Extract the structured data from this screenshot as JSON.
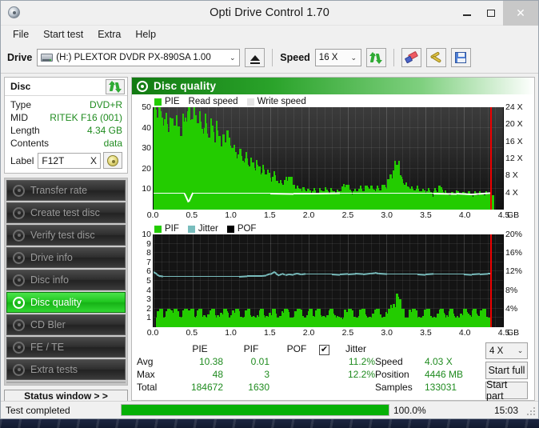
{
  "window": {
    "title": "Opti Drive Control 1.70",
    "app_icon": "disc-icon",
    "minimize": "–",
    "maximize": "□",
    "close": "✕"
  },
  "menu": {
    "items": [
      "File",
      "Start test",
      "Extra",
      "Help"
    ]
  },
  "toolbar": {
    "drive_label": "Drive",
    "drive_value": "(H:)  PLEXTOR DVDR  PX-890SA 1.00",
    "eject_tooltip": "Eject",
    "speed_label": "Speed",
    "speed_value": "16 X",
    "caret": "⌄",
    "icons": [
      "refresh-icon",
      "eraser-icon",
      "tools-icon",
      "save-icon"
    ]
  },
  "disc_panel": {
    "title": "Disc",
    "refresh_icon": "refresh-icon",
    "rows": [
      {
        "key": "Type",
        "value": "DVD+R"
      },
      {
        "key": "MID",
        "value": "RITEK F16 (001)"
      },
      {
        "key": "Length",
        "value": "4.34 GB"
      },
      {
        "key": "Contents",
        "value": "data"
      }
    ],
    "label_key": "Label",
    "label_value": "F12T",
    "label_clear": "X",
    "label_button_icon": "disc-icon"
  },
  "nav": {
    "items": [
      {
        "label": "Transfer rate",
        "icon": "disc-test-icon",
        "active": false
      },
      {
        "label": "Create test disc",
        "icon": "disc-test-icon",
        "active": false
      },
      {
        "label": "Verify test disc",
        "icon": "disc-test-icon",
        "active": false
      },
      {
        "label": "Drive info",
        "icon": "disc-info-icon",
        "active": false
      },
      {
        "label": "Disc info",
        "icon": "disc-info-icon",
        "active": false
      },
      {
        "label": "Disc quality",
        "icon": "disc-quality-icon",
        "active": true
      },
      {
        "label": "CD Bler",
        "icon": "disc-test-icon",
        "active": false
      },
      {
        "label": "FE / TE",
        "icon": "disc-test-icon",
        "active": false
      },
      {
        "label": "Extra tests",
        "icon": "disc-test-icon",
        "active": false
      }
    ],
    "status_window_button": "Status window > >"
  },
  "main": {
    "header_title": "Disc quality",
    "header_icon": "disc-quality-icon"
  },
  "stats": {
    "headers": [
      "PIE",
      "PIF",
      "POF",
      "Jitter"
    ],
    "jitter_checked": true,
    "jitter_check_glyph": "✔",
    "rows": [
      {
        "label": "Avg",
        "pie": "10.38",
        "pif": "0.01",
        "pof": "",
        "jitter": "11.2%"
      },
      {
        "label": "Max",
        "pie": "48",
        "pif": "3",
        "pof": "",
        "jitter": "12.2%"
      },
      {
        "label": "Total",
        "pie": "184672",
        "pif": "1630",
        "pof": "",
        "jitter": ""
      }
    ],
    "speed_key": "Speed",
    "speed_value": "4.03 X",
    "position_key": "Position",
    "position_value": "4446 MB",
    "samples_key": "Samples",
    "samples_value": "133031",
    "test_speed_value": "4 X",
    "caret": "⌄",
    "start_full": "Start full",
    "start_part": "Start part"
  },
  "statusbar": {
    "text": "Test completed",
    "percent_label": "100.0%",
    "percent_value": 100,
    "time": "15:03"
  },
  "colors": {
    "pie_green": "#23cc00",
    "pif_green": "#23cc00",
    "jitter_teal": "#79bdbd",
    "read_speed_white": "#ffffff",
    "marker_red": "#ee0000",
    "accent_green": "#1fc51f",
    "value_green": "#1f8b1f"
  },
  "chart_data": [
    {
      "type": "area",
      "name": "pie-chart",
      "title": "PIE",
      "legend": [
        {
          "label": "PIE",
          "swatch": "#23cc00"
        },
        {
          "label": "Read speed",
          "swatch": "#ffffff"
        },
        {
          "label": "Write speed",
          "swatch": "#e4e4e4"
        }
      ],
      "xlabel": "GB",
      "xlim": [
        0,
        4.5
      ],
      "xticks": [
        0.0,
        0.5,
        1.0,
        1.5,
        2.0,
        2.5,
        3.0,
        3.5,
        4.0,
        4.5
      ],
      "xticklabels": [
        "0.0",
        "0.5",
        "1.0",
        "1.5",
        "2.0",
        "2.5",
        "3.0",
        "3.5",
        "4.0",
        "4.5"
      ],
      "ylim": [
        0,
        50
      ],
      "yticks": [
        10,
        20,
        30,
        40,
        50
      ],
      "yticklabels": [
        "10",
        "20",
        "30",
        "40",
        "50"
      ],
      "y2lim": [
        0,
        24
      ],
      "y2ticks": [
        4,
        8,
        12,
        16,
        20,
        24
      ],
      "y2ticklabels": [
        "4 X",
        "8 X",
        "12 X",
        "16 X",
        "20 X",
        "24 X"
      ],
      "grid": true,
      "data_end_x": 4.34,
      "marker_x": 4.34,
      "series": [
        {
          "name": "PIE",
          "kind": "bars",
          "x": [
            0.0,
            0.04,
            0.09,
            0.13,
            0.17,
            0.22,
            0.26,
            0.3,
            0.35,
            0.39,
            0.43,
            0.48,
            0.52,
            0.56,
            0.61,
            0.65,
            0.69,
            0.74,
            0.78,
            0.82,
            0.87,
            0.91,
            0.95,
            1.0,
            1.04,
            1.08,
            1.13,
            1.17,
            1.21,
            1.26,
            1.3,
            1.34,
            1.39,
            1.43,
            1.47,
            1.52,
            1.56,
            1.6,
            1.65,
            1.69,
            1.73,
            1.78,
            1.82,
            1.86,
            1.91,
            1.95,
            1.99,
            2.04,
            2.08,
            2.12,
            2.17,
            2.21,
            2.25,
            2.3,
            2.34,
            2.38,
            2.43,
            2.47,
            2.51,
            2.56,
            2.6,
            2.64,
            2.69,
            2.73,
            2.77,
            2.82,
            2.86,
            2.9,
            2.95,
            2.99,
            3.03,
            3.08,
            3.12,
            3.16,
            3.21,
            3.25,
            3.29,
            3.34,
            3.38,
            3.42,
            3.47,
            3.51,
            3.55,
            3.6,
            3.64,
            3.68,
            3.73,
            3.77,
            3.81,
            3.86,
            3.9,
            3.94,
            3.99,
            4.03,
            4.07,
            4.12,
            4.16,
            4.2,
            4.25,
            4.29,
            4.34
          ],
          "values": [
            49,
            45,
            41,
            44,
            38,
            34,
            41,
            39,
            36,
            43,
            48,
            44,
            40,
            42,
            37,
            40,
            35,
            38,
            33,
            36,
            31,
            33,
            29,
            30,
            25,
            27,
            23,
            25,
            21,
            22,
            19,
            21,
            18,
            17,
            15,
            16,
            14,
            13,
            12,
            11,
            16,
            12,
            10,
            10,
            9,
            9,
            8,
            9,
            8,
            8,
            9,
            9,
            8,
            9,
            8,
            9,
            9,
            12,
            9,
            9,
            8,
            10,
            9,
            11,
            10,
            9,
            10,
            9,
            11,
            10,
            14,
            19,
            22,
            16,
            12,
            11,
            10,
            9,
            10,
            9,
            8,
            9,
            8,
            9,
            8,
            11,
            8,
            7,
            7,
            8,
            7,
            8,
            7,
            8,
            7,
            8,
            7,
            8,
            7,
            8,
            7
          ]
        },
        {
          "name": "Read speed",
          "kind": "line",
          "axis": "right",
          "x": [
            0.0,
            0.2,
            0.4,
            0.45,
            0.5,
            0.6,
            0.9,
            1.2,
            1.5,
            1.8,
            2.1,
            2.4,
            2.7,
            3.0,
            3.3,
            3.6,
            3.9,
            4.1,
            4.34
          ],
          "values": [
            4.0,
            4.0,
            4.0,
            2.0,
            4.0,
            4.0,
            4.0,
            4.0,
            4.0,
            3.9,
            3.9,
            4.0,
            4.0,
            4.0,
            4.0,
            4.0,
            3.9,
            3.7,
            4.0
          ]
        }
      ]
    },
    {
      "type": "area",
      "name": "pif-jitter-chart",
      "title": "PIF / Jitter / POF",
      "legend": [
        {
          "label": "PIF",
          "swatch": "#23cc00"
        },
        {
          "label": "Jitter",
          "swatch": "#79bdbd"
        },
        {
          "label": "POF",
          "swatch": "#000000"
        }
      ],
      "xlabel": "GB",
      "xlim": [
        0,
        4.5
      ],
      "xticks": [
        0.0,
        0.5,
        1.0,
        1.5,
        2.0,
        2.5,
        3.0,
        3.5,
        4.0,
        4.5
      ],
      "xticklabels": [
        "0.0",
        "0.5",
        "1.0",
        "1.5",
        "2.0",
        "2.5",
        "3.0",
        "3.5",
        "4.0",
        "4.5"
      ],
      "ylim": [
        0,
        10
      ],
      "yticks": [
        1,
        2,
        3,
        4,
        5,
        6,
        7,
        8,
        9,
        10
      ],
      "yticklabels": [
        "1",
        "2",
        "3",
        "4",
        "5",
        "6",
        "7",
        "8",
        "9",
        "10"
      ],
      "y2lim": [
        0,
        20
      ],
      "y2ticks": [
        4,
        8,
        12,
        16,
        20
      ],
      "y2ticklabels": [
        "4%",
        "8%",
        "12%",
        "16%",
        "20%"
      ],
      "grid": true,
      "data_end_x": 4.34,
      "marker_x": 4.34,
      "series": [
        {
          "name": "PIF",
          "kind": "bars",
          "x": [
            0.03,
            0.07,
            0.1,
            0.14,
            0.17,
            0.21,
            0.26,
            0.31,
            0.35,
            0.39,
            0.44,
            0.47,
            0.5,
            0.54,
            0.58,
            0.63,
            0.68,
            0.74,
            0.79,
            0.84,
            0.9,
            0.95,
            1.0,
            1.05,
            1.1,
            1.15,
            1.2,
            1.26,
            1.31,
            1.37,
            1.42,
            1.47,
            1.52,
            1.57,
            1.63,
            1.68,
            1.74,
            1.79,
            1.84,
            1.9,
            1.95,
            2.0,
            2.05,
            2.1,
            2.16,
            2.21,
            2.27,
            2.33,
            2.38,
            2.44,
            2.5,
            2.56,
            2.62,
            2.68,
            2.74,
            2.8,
            2.86,
            2.92,
            2.97,
            3.02,
            3.07,
            3.12,
            3.14,
            3.16,
            3.18,
            3.22,
            3.27,
            3.33,
            3.39,
            3.45,
            3.51,
            3.57,
            3.63,
            3.69,
            3.75,
            3.81,
            3.87,
            3.93,
            3.99,
            4.05,
            4.11,
            4.17,
            4.23,
            4.29
          ],
          "values": [
            1,
            2,
            1,
            1,
            2,
            1,
            2,
            1,
            1,
            2,
            1,
            2,
            1,
            1,
            2,
            1,
            1,
            2,
            1,
            1,
            2,
            1,
            1,
            2,
            1,
            1,
            2,
            1,
            1,
            2,
            1,
            1,
            2,
            1,
            1,
            2,
            1,
            1,
            2,
            1,
            1,
            2,
            1,
            2,
            1,
            1,
            2,
            1,
            1,
            1,
            2,
            1,
            1,
            2,
            1,
            1,
            2,
            1,
            1,
            2,
            2,
            3,
            3,
            2,
            2,
            1,
            1,
            2,
            1,
            1,
            2,
            1,
            1,
            2,
            1,
            2,
            1,
            1,
            2,
            1,
            2,
            1,
            2,
            1
          ]
        },
        {
          "name": "Jitter",
          "kind": "line",
          "axis": "right",
          "x": [
            0.0,
            0.04,
            0.08,
            0.12,
            0.2,
            0.3,
            0.4,
            0.5,
            0.6,
            0.7,
            0.8,
            0.9,
            1.0,
            1.1,
            1.2,
            1.3,
            1.4,
            1.45,
            1.5,
            1.55,
            1.58,
            1.62,
            1.66,
            1.7,
            1.75,
            1.8,
            1.85,
            1.9,
            1.95,
            2.0,
            2.1,
            2.2,
            2.3,
            2.4,
            2.5,
            2.6,
            2.7,
            2.8,
            2.85,
            2.9,
            3.0,
            3.1,
            3.2,
            3.3,
            3.4,
            3.5,
            3.6,
            3.7,
            3.8,
            3.9,
            4.0,
            4.1,
            4.2,
            4.3,
            4.34
          ],
          "values": [
            12.0,
            11.6,
            11.2,
            11.1,
            11.1,
            11.1,
            11.1,
            11.1,
            11.1,
            11.1,
            11.1,
            11.1,
            11.1,
            11.1,
            11.2,
            11.2,
            11.2,
            11.3,
            11.6,
            12.1,
            11.8,
            11.4,
            11.7,
            11.4,
            11.6,
            11.5,
            11.7,
            11.5,
            11.6,
            11.6,
            11.6,
            11.6,
            11.6,
            11.5,
            11.6,
            11.7,
            11.6,
            11.8,
            11.9,
            11.7,
            11.6,
            11.6,
            11.6,
            11.6,
            11.6,
            11.5,
            11.6,
            11.6,
            11.6,
            11.6,
            11.6,
            11.5,
            11.6,
            11.7,
            11.7
          ]
        }
      ]
    }
  ]
}
